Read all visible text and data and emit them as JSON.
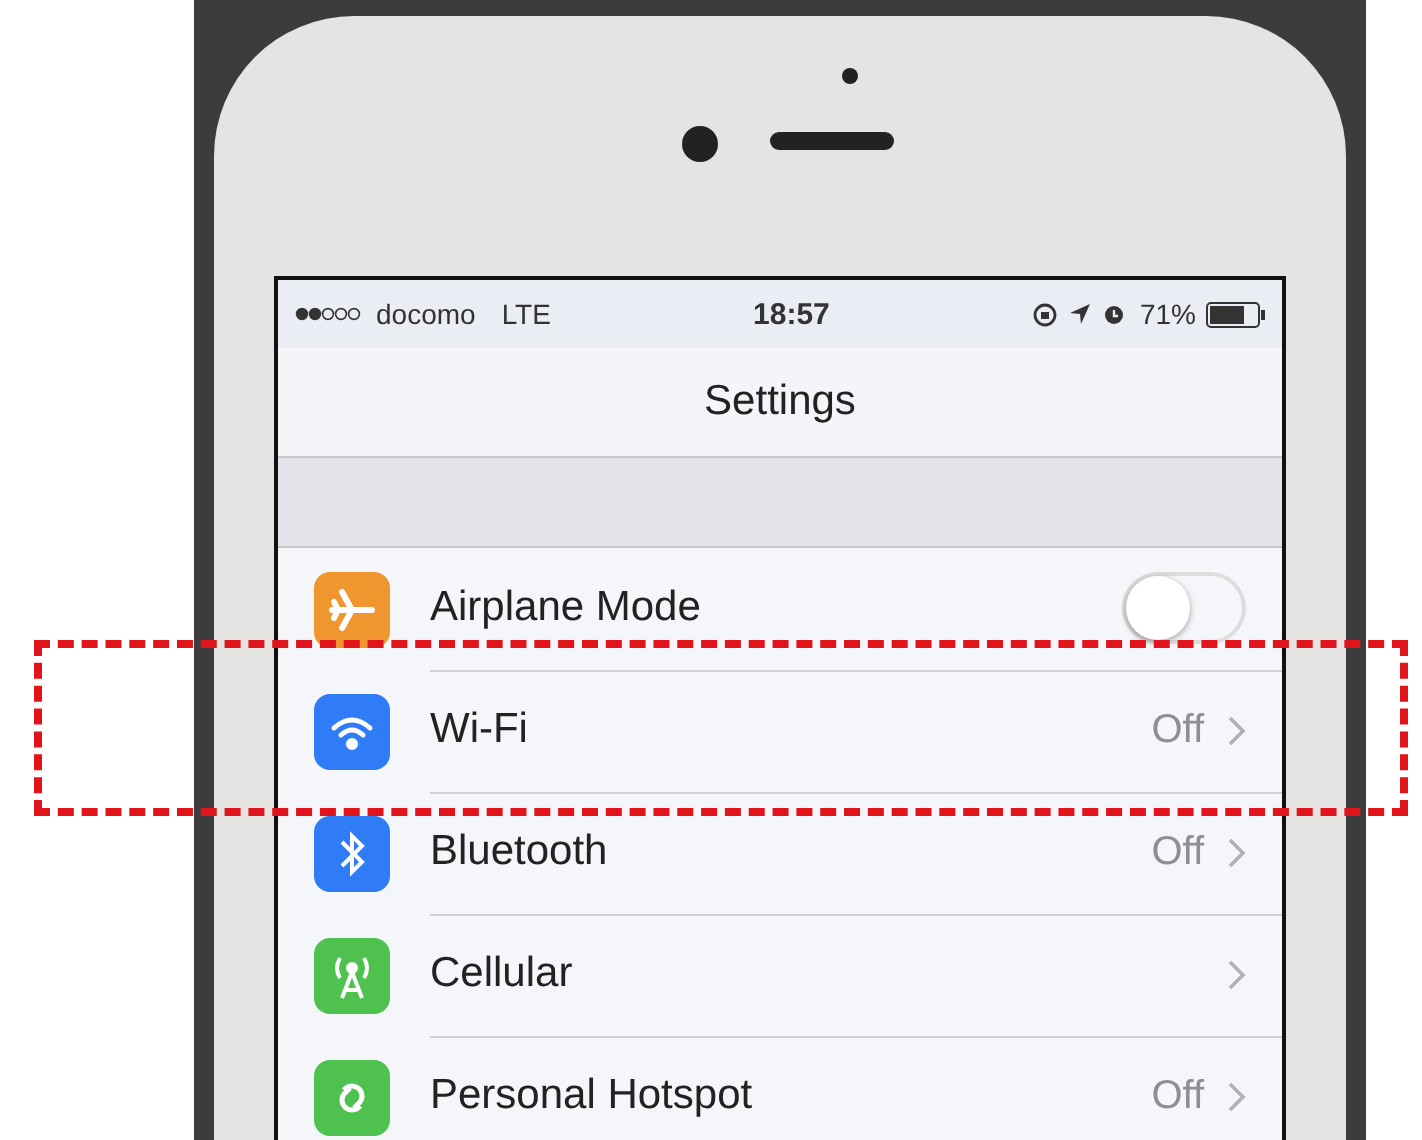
{
  "status_bar": {
    "carrier": "docomo",
    "network": "LTE",
    "time": "18:57",
    "battery": "71%"
  },
  "nav": {
    "title": "Settings"
  },
  "rows": [
    {
      "kind": "toggle",
      "label": "Airplane Mode",
      "on": false,
      "highlighted": false
    },
    {
      "kind": "value",
      "label": "Wi-Fi",
      "value": "Off",
      "highlighted": true
    },
    {
      "kind": "value",
      "label": "Bluetooth",
      "value": "Off",
      "highlighted": false
    },
    {
      "kind": "value",
      "label": "Cellular",
      "highlighted": false
    },
    {
      "kind": "value",
      "label": "Personal Hotspot",
      "value": "Off",
      "highlighted": false
    }
  ]
}
